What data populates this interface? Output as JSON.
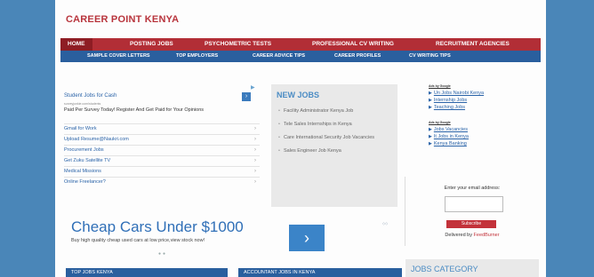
{
  "site": {
    "brand": "CAREER POINT KENYA"
  },
  "nav_primary": [
    "HOME",
    "POSTING JOBS",
    "PSYCHOMETRIC TESTS",
    "PROFESSIONAL CV WRITING",
    "RECRUITMENT AGENCIES"
  ],
  "nav_secondary": [
    "SAMPLE COVER LETTERS",
    "TOP EMPLOYERS",
    "CAREER ADVICE TIPS",
    "CAREER PROFILES",
    "CV WRITING TIPS"
  ],
  "ad_block": {
    "title": "Student Jobs for Cash",
    "url": "surveyjunkie.com/students",
    "description": "Paid Per Survey Today! Register And Get Paid for Your Opinions",
    "links": [
      "Gmail for Work",
      "Upload Resume@Naukri.com",
      "Procurement Jobs",
      "Get Zuku Satellite TV",
      "Medical Missions",
      "Online Freelancer?"
    ]
  },
  "big_ad": {
    "headline": "Cheap Cars Under $1000",
    "subtext": "Buy high quality cheap used cars at low price,view stock now!"
  },
  "new_jobs": {
    "heading": "NEW JOBS",
    "items": [
      "Facility Administrator Kenya Job",
      "Tele Sales Internships in Kenya",
      "Care International Security Job Vacancies",
      "Sales Engineer Job Kenya"
    ]
  },
  "right_ads": {
    "group1_label": "Ads by Google",
    "group1": [
      "Un Jobs Nairobi Kenya",
      "Internship Jobs",
      "Teaching Jobs"
    ],
    "group2_label": "Ads by Google",
    "group2": [
      "Jobs Vacancies",
      "It Jobs in Kenya",
      "Kenya Banking"
    ]
  },
  "subscribe": {
    "label": "Enter your email address:",
    "button": "Subscribe",
    "delivered_prefix": "Delivered by ",
    "delivered_brand": "FeedBurner"
  },
  "bottom": {
    "bar1": "TOP JOBS KENYA",
    "bar2": "ACCOUNTANT JOBS IN KENYA",
    "jobs_category": "JOBS CATEGORY"
  },
  "colors": {
    "brand_red": "#b22e36",
    "nav_blue": "#2a5f9e",
    "link_blue": "#2a63a8",
    "frame_blue": "#4a86b8"
  }
}
